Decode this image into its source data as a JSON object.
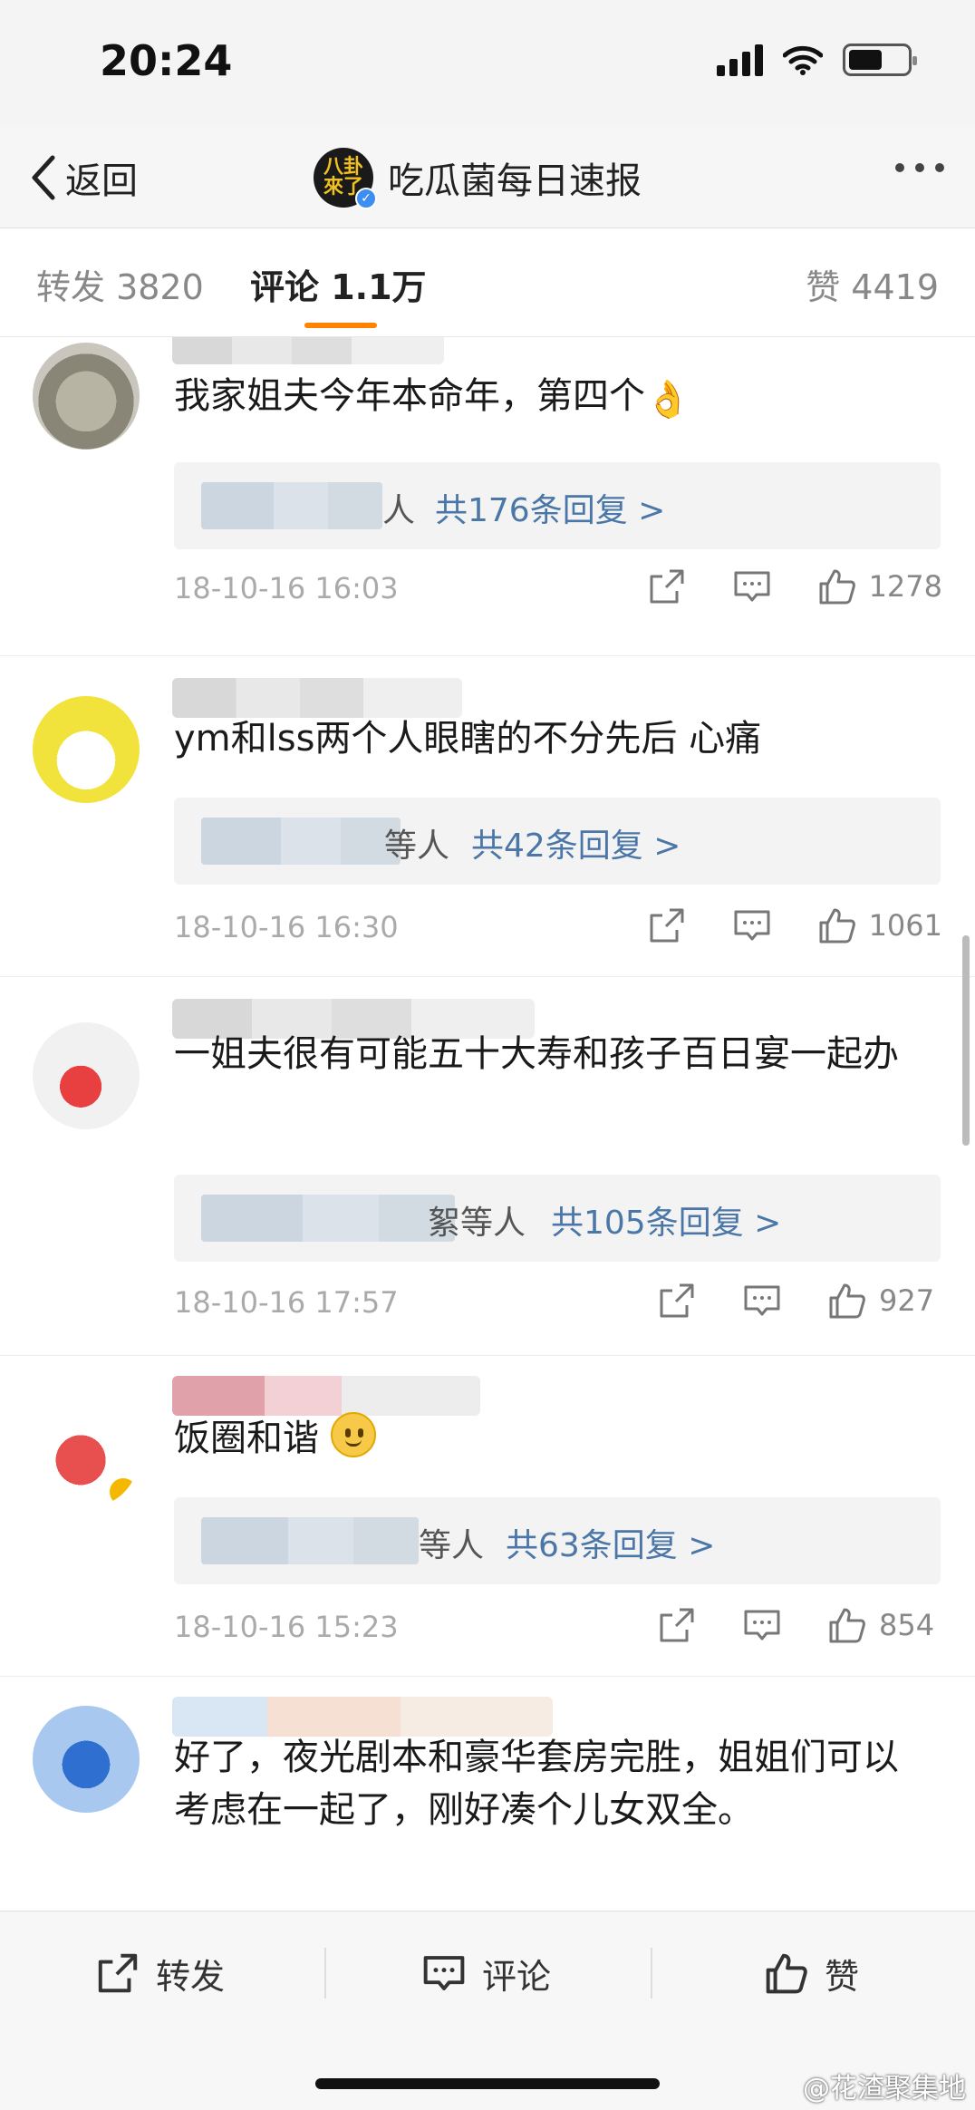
{
  "status_bar": {
    "time": "20:24"
  },
  "nav": {
    "back_label": "返回",
    "account_name": "吃瓜菌每日速报",
    "avatar_glyph": "八卦\n來了"
  },
  "tabs": {
    "repost": "转发 3820",
    "comment": "评论 1.1万",
    "like": "赞 4419"
  },
  "comments": [
    {
      "text": "我家姐夫今年本命年，第四个",
      "reply_prefix": "人",
      "reply_link": "共176条回复 >",
      "time": "18-10-16 16:03",
      "likes": "1278"
    },
    {
      "text": "ym和lss两个人眼瞎的不分先后 心痛",
      "reply_prefix": "等人",
      "reply_link": "共42条回复 >",
      "time": "18-10-16 16:30",
      "likes": "1061"
    },
    {
      "text": "一姐夫很有可能五十大寿和孩子百日宴一起办",
      "reply_prefix": "絮等人",
      "reply_link": "共105条回复 >",
      "time": "18-10-16 17:57",
      "likes": "927"
    },
    {
      "text": "饭圈和谐",
      "reply_prefix": "等人",
      "reply_link": "共63条回复 >",
      "time": "18-10-16 15:23",
      "likes": "854"
    },
    {
      "text": "好了，夜光剧本和豪华套房完胜，姐姐们可以考虑在一起了，刚好凑个儿女双全。"
    }
  ],
  "bottom_bar": {
    "repost": "转发",
    "comment": "评论",
    "like": "赞"
  },
  "watermark": "@花渣聚集地",
  "icons": {
    "share": "share-icon",
    "comment": "comment-icon",
    "like": "thumbs-up-icon",
    "back": "chevron-left-icon",
    "more": "more-dots-icon"
  },
  "colors": {
    "accent": "#ff8200",
    "link": "#4a76a8",
    "verified": "#3d8ef0"
  }
}
